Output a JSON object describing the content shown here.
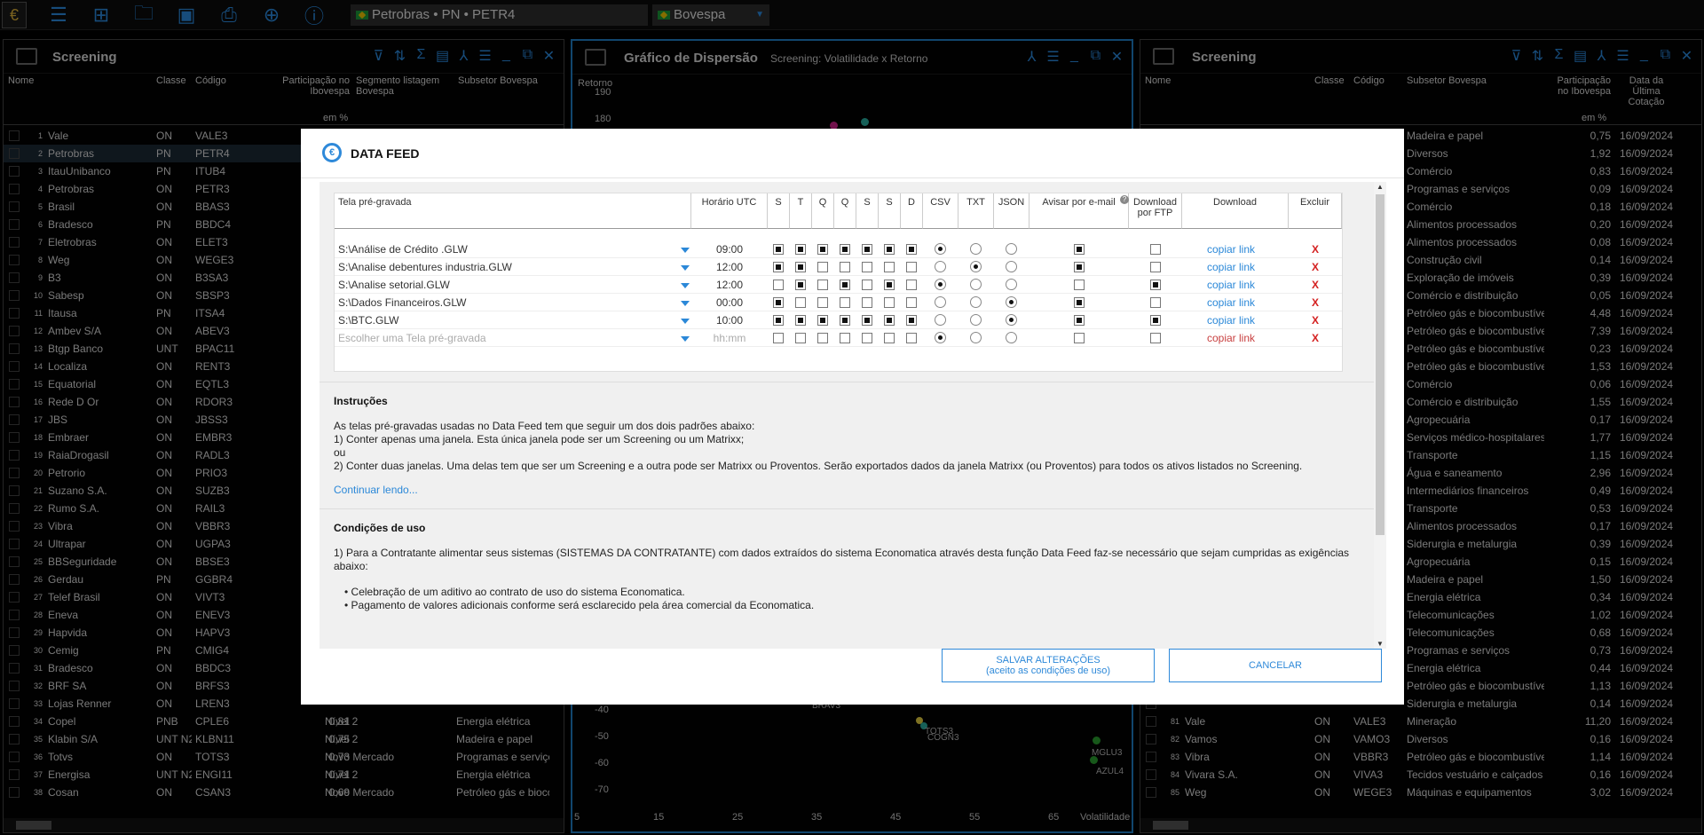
{
  "topbar": {
    "logo": "€",
    "asset": "Petrobras • PN • PETR4",
    "exchange": "Bovespa"
  },
  "left_panel": {
    "title": "Screening",
    "cols": [
      "Nome",
      "Classe",
      "Código",
      "Participação no Ibovespa",
      "Segmento listagem Bovespa",
      "Subsetor Bovespa"
    ],
    "unit": "em %",
    "rows": [
      [
        "1",
        "Vale",
        "ON",
        "VALE3",
        "",
        ""
      ],
      [
        "2",
        "Petrobras",
        "PN",
        "PETR4",
        "",
        ""
      ],
      [
        "3",
        "ItauUnibanco",
        "PN",
        "ITUB4",
        "",
        ""
      ],
      [
        "4",
        "Petrobras",
        "ON",
        "PETR3",
        "",
        ""
      ],
      [
        "5",
        "Brasil",
        "ON",
        "BBAS3",
        "",
        ""
      ],
      [
        "6",
        "Bradesco",
        "PN",
        "BBDC4",
        "",
        ""
      ],
      [
        "7",
        "Eletrobras",
        "ON",
        "ELET3",
        "",
        ""
      ],
      [
        "8",
        "Weg",
        "ON",
        "WEGE3",
        "",
        ""
      ],
      [
        "9",
        "B3",
        "ON",
        "B3SA3",
        "",
        ""
      ],
      [
        "10",
        "Sabesp",
        "ON",
        "SBSP3",
        "",
        ""
      ],
      [
        "11",
        "Itausa",
        "PN",
        "ITSA4",
        "",
        ""
      ],
      [
        "12",
        "Ambev S/A",
        "ON",
        "ABEV3",
        "",
        ""
      ],
      [
        "13",
        "Btgp Banco",
        "UNT",
        "BPAC11",
        "",
        ""
      ],
      [
        "14",
        "Localiza",
        "ON",
        "RENT3",
        "",
        ""
      ],
      [
        "15",
        "Equatorial",
        "ON",
        "EQTL3",
        "",
        ""
      ],
      [
        "16",
        "Rede D Or",
        "ON",
        "RDOR3",
        "",
        ""
      ],
      [
        "17",
        "JBS",
        "ON",
        "JBSS3",
        "",
        ""
      ],
      [
        "18",
        "Embraer",
        "ON",
        "EMBR3",
        "",
        ""
      ],
      [
        "19",
        "RaiaDrogasil",
        "ON",
        "RADL3",
        "",
        ""
      ],
      [
        "20",
        "Petrorio",
        "ON",
        "PRIO3",
        "",
        ""
      ],
      [
        "21",
        "Suzano S.A.",
        "ON",
        "SUZB3",
        "",
        ""
      ],
      [
        "22",
        "Rumo S.A.",
        "ON",
        "RAIL3",
        "",
        ""
      ],
      [
        "23",
        "Vibra",
        "ON",
        "VBBR3",
        "",
        ""
      ],
      [
        "24",
        "Ultrapar",
        "ON",
        "UGPA3",
        "",
        ""
      ],
      [
        "25",
        "BBSeguridade",
        "ON",
        "BBSE3",
        "",
        ""
      ],
      [
        "26",
        "Gerdau",
        "PN",
        "GGBR4",
        "",
        ""
      ],
      [
        "27",
        "Telef Brasil",
        "ON",
        "VIVT3",
        "",
        ""
      ],
      [
        "28",
        "Eneva",
        "ON",
        "ENEV3",
        "",
        ""
      ],
      [
        "29",
        "Hapvida",
        "ON",
        "HAPV3",
        "",
        ""
      ],
      [
        "30",
        "Cemig",
        "PN",
        "CMIG4",
        "",
        ""
      ],
      [
        "31",
        "Bradesco",
        "ON",
        "BBDC3",
        "",
        ""
      ],
      [
        "32",
        "BRF SA",
        "ON",
        "BRFS3",
        "",
        ""
      ],
      [
        "33",
        "Lojas Renner",
        "ON",
        "LREN3",
        "",
        ""
      ],
      [
        "34",
        "Copel",
        "PNB",
        "CPLE6",
        "0,81",
        "Nível 2",
        "Energia elétrica"
      ],
      [
        "35",
        "Klabin S/A",
        "UNT N2",
        "KLBN11",
        "0,75",
        "Nível 2",
        "Madeira e papel"
      ],
      [
        "36",
        "Totvs",
        "ON",
        "TOTS3",
        "0,73",
        "Novo Mercado",
        "Programas e serviços"
      ],
      [
        "37",
        "Energisa",
        "UNT N2",
        "ENGI11",
        "0,71",
        "Nível 2",
        "Energia elétrica"
      ],
      [
        "38",
        "Cosan",
        "ON",
        "CSAN3",
        "0,69",
        "Novo Mercado",
        "Petróleo gás e biocombustíveis"
      ]
    ]
  },
  "mid_panel": {
    "title": "Gráfico de Dispersão",
    "subtitle": "Screening: Volatilidade x Retorno",
    "ylabel": "Retorno",
    "xlabel": "Volatilidade",
    "yticks_top": [
      "190",
      "180"
    ],
    "yticks_bottom": [
      "-40",
      "-50",
      "-60",
      "-70"
    ],
    "xticks": [
      "5",
      "15",
      "25",
      "35",
      "45",
      "55",
      "65"
    ],
    "points": [
      "TOTS3",
      "COGN3",
      "MGLU3",
      "AZUL4",
      "BRAV3"
    ]
  },
  "right_panel": {
    "title": "Screening",
    "cols": [
      "Nome",
      "Classe",
      "Código",
      "Subsetor Bovespa",
      "Participação no Ibovespa",
      "Data da Última Cotação"
    ],
    "unit": "em %",
    "rows": [
      [
        "",
        "",
        "",
        "Madeira e papel",
        "0,75",
        "16/09/2024"
      ],
      [
        "",
        "",
        "",
        "Diversos",
        "1,92",
        "16/09/2024"
      ],
      [
        "",
        "",
        "",
        "Comércio",
        "0,83",
        "16/09/2024"
      ],
      [
        "",
        "",
        "",
        "Programas e serviços",
        "0,09",
        "16/09/2024"
      ],
      [
        "",
        "",
        "",
        "Comércio",
        "0,18",
        "16/09/2024"
      ],
      [
        "",
        "",
        "",
        "Alimentos processados",
        "0,20",
        "16/09/2024"
      ],
      [
        "",
        "",
        "",
        "Alimentos processados",
        "0,08",
        "16/09/2024"
      ],
      [
        "",
        "",
        "",
        "Construção civil",
        "0,14",
        "16/09/2024"
      ],
      [
        "",
        "",
        "",
        "Exploração de imóveis",
        "0,39",
        "16/09/2024"
      ],
      [
        "",
        "",
        "",
        "Comércio e distribuição",
        "0,05",
        "16/09/2024"
      ],
      [
        "",
        "",
        "",
        "Petróleo gás e biocombustíveis",
        "4,48",
        "16/09/2024"
      ],
      [
        "",
        "",
        "",
        "Petróleo gás e biocombustíveis",
        "7,39",
        "16/09/2024"
      ],
      [
        "",
        "",
        "",
        "Petróleo gás e biocombustíveis",
        "0,23",
        "16/09/2024"
      ],
      [
        "",
        "",
        "",
        "Petróleo gás e biocombustíveis",
        "1,53",
        "16/09/2024"
      ],
      [
        "",
        "",
        "",
        "Comércio",
        "0,06",
        "16/09/2024"
      ],
      [
        "",
        "",
        "",
        "Comércio e distribuição",
        "1,55",
        "16/09/2024"
      ],
      [
        "",
        "",
        "",
        "Agropecuária",
        "0,17",
        "16/09/2024"
      ],
      [
        "",
        "",
        "",
        "Serviços médico-hospitalares...",
        "1,77",
        "16/09/2024"
      ],
      [
        "",
        "",
        "",
        "Transporte",
        "1,15",
        "16/09/2024"
      ],
      [
        "",
        "",
        "",
        "Água e saneamento",
        "2,96",
        "16/09/2024"
      ],
      [
        "",
        "",
        "",
        "Intermediários financeiros",
        "0,49",
        "16/09/2024"
      ],
      [
        "",
        "",
        "",
        "Transporte",
        "0,53",
        "16/09/2024"
      ],
      [
        "",
        "",
        "",
        "Alimentos processados",
        "0,17",
        "16/09/2024"
      ],
      [
        "",
        "",
        "",
        "Siderurgia e metalurgia",
        "0,39",
        "16/09/2024"
      ],
      [
        "",
        "",
        "",
        "Agropecuária",
        "0,15",
        "16/09/2024"
      ],
      [
        "",
        "",
        "",
        "Madeira e papel",
        "1,50",
        "16/09/2024"
      ],
      [
        "",
        "",
        "",
        "Energia elétrica",
        "0,34",
        "16/09/2024"
      ],
      [
        "",
        "",
        "",
        "Telecomunicações",
        "1,02",
        "16/09/2024"
      ],
      [
        "",
        "",
        "",
        "Telecomunicações",
        "0,68",
        "16/09/2024"
      ],
      [
        "",
        "",
        "",
        "Programas e serviços",
        "0,73",
        "16/09/2024"
      ],
      [
        "",
        "",
        "",
        "Energia elétrica",
        "0,44",
        "16/09/2024"
      ],
      [
        "",
        "",
        "",
        "Petróleo gás e biocombustíveis",
        "1,13",
        "16/09/2024"
      ],
      [
        "",
        "",
        "",
        "Siderurgia e metalurgia",
        "0,14",
        "16/09/2024"
      ],
      [
        "81",
        "Vale",
        "ON",
        "VALE3",
        "Mineração",
        "11,20",
        "16/09/2024"
      ],
      [
        "82",
        "Vamos",
        "ON",
        "VAMO3",
        "Diversos",
        "0,16",
        "16/09/2024"
      ],
      [
        "83",
        "Vibra",
        "ON",
        "VBBR3",
        "Petróleo gás e biocombustíveis",
        "1,14",
        "16/09/2024"
      ],
      [
        "84",
        "Vivara S.A.",
        "ON",
        "VIVA3",
        "Tecidos vestuário e calçados",
        "0,16",
        "16/09/2024"
      ],
      [
        "85",
        "Weg",
        "ON",
        "WEGE3",
        "Máquinas e equipamentos",
        "3,02",
        "16/09/2024"
      ]
    ]
  },
  "modal": {
    "title": "DATA FEED",
    "headers": [
      "Tela pré-gravada",
      "Horário UTC",
      "S",
      "T",
      "Q",
      "Q",
      "S",
      "S",
      "D",
      "CSV",
      "TXT",
      "JSON",
      "Avisar por e-mail",
      "Download por FTP",
      "Download",
      "Excluir"
    ],
    "rows": [
      {
        "file": "S:\\Análise de Crédito .GLW",
        "time": "09:00",
        "days": [
          1,
          1,
          1,
          1,
          1,
          1,
          1
        ],
        "fmt": "CSV",
        "email": 1,
        "ftp": 0,
        "link": "copiar link",
        "del": "X"
      },
      {
        "file": "S:\\Analise debentures industria.GLW",
        "time": "12:00",
        "days": [
          1,
          1,
          0,
          0,
          0,
          0,
          0
        ],
        "fmt": "TXT",
        "email": 1,
        "ftp": 0,
        "link": "copiar link",
        "del": "X"
      },
      {
        "file": "S:\\Analise setorial.GLW",
        "time": "12:00",
        "days": [
          0,
          1,
          0,
          1,
          0,
          1,
          0
        ],
        "fmt": "CSV",
        "email": 0,
        "ftp": 1,
        "link": "copiar link",
        "del": "X"
      },
      {
        "file": "S:\\Dados Financeiros.GLW",
        "time": "00:00",
        "days": [
          1,
          0,
          0,
          0,
          0,
          0,
          0
        ],
        "fmt": "JSON",
        "email": 1,
        "ftp": 0,
        "link": "copiar link",
        "del": "X"
      },
      {
        "file": "S:\\BTC.GLW",
        "time": "10:00",
        "days": [
          1,
          1,
          1,
          1,
          1,
          1,
          1
        ],
        "fmt": "JSON",
        "email": 1,
        "ftp": 1,
        "link": "copiar link",
        "del": "X"
      },
      {
        "file": "Escolher uma Tela pré-gravada",
        "time": "hh:mm",
        "days": [
          0,
          0,
          0,
          0,
          0,
          0,
          0
        ],
        "fmt": "CSV",
        "email": 0,
        "ftp": 0,
        "link": "copiar link",
        "del": "X",
        "placeholder": true
      }
    ],
    "instr_title": "Instruções",
    "instr": [
      "As telas pré-gravadas usadas no Data Feed tem que seguir um dos dois padrões abaixo:",
      "1) Conter apenas uma janela. Esta única janela pode ser um Screening ou um Matrixx;",
      "ou",
      "2) Conter duas janelas. Uma delas tem que ser  um Screening e a outra pode ser  Matrixx ou Proventos. Serão exportados dados da janela Matrixx (ou Proventos) para todos os ativos listados no Screening."
    ],
    "more": "Continuar lendo...",
    "cond_title": "Condições de uso",
    "cond": [
      "1) Para a Contratante alimentar seus sistemas (SISTEMAS DA CONTRATANTE) com dados extraídos do sistema Economatica através desta função Data Feed faz-se necessário que sejam cumpridas as exigências abaixo:",
      "• Celebração de um aditivo ao contrato de uso do sistema Economatica.",
      "• Pagamento de valores adicionais conforme será esclarecido pela área comercial da Economatica."
    ],
    "save1": "SALVAR ALTERAÇÕES",
    "save2": "(aceito as condições de uso)",
    "cancel": "CANCELAR"
  }
}
